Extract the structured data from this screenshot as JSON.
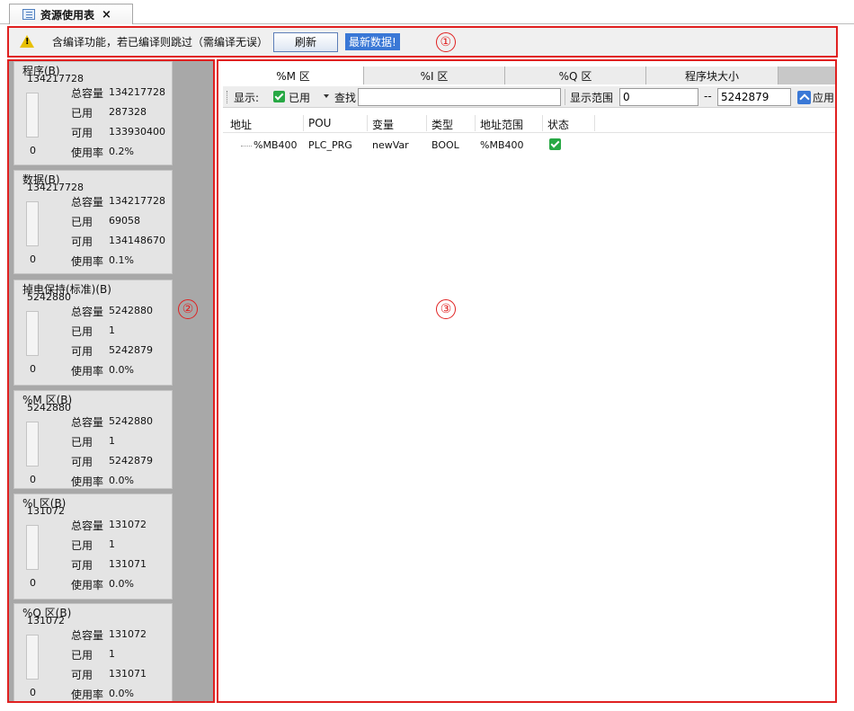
{
  "window": {
    "tab_title": "资源使用表",
    "tab_close": "×"
  },
  "warning_bar": {
    "icon": "warning-icon",
    "message": "含编译功能，若已编译则跳过（需编译无误）",
    "refresh_label": "刷新",
    "latest_label": "最新数据!",
    "callout": "①"
  },
  "left_panel": {
    "callout": "②",
    "labels": {
      "total": "总容量",
      "used": "已用",
      "free": "可用",
      "rate": "使用率"
    },
    "cards": [
      {
        "title": "程序(B)",
        "capacity": "134217728",
        "total": "134217728",
        "used": "287328",
        "free": "133930400",
        "rate": "0.2%",
        "zero": "0"
      },
      {
        "title": "数据(B)",
        "capacity": "134217728",
        "total": "134217728",
        "used": "69058",
        "free": "134148670",
        "rate": "0.1%",
        "zero": "0"
      },
      {
        "title": "掉电保持(标准)(B)",
        "capacity": "5242880",
        "total": "5242880",
        "used": "1",
        "free": "5242879",
        "rate": "0.0%",
        "zero": "0"
      },
      {
        "title": "%M 区(B)",
        "capacity": "5242880",
        "total": "5242880",
        "used": "1",
        "free": "5242879",
        "rate": "0.0%",
        "zero": "0"
      },
      {
        "title": "%I 区(B)",
        "capacity": "131072",
        "total": "131072",
        "used": "1",
        "free": "131071",
        "rate": "0.0%",
        "zero": "0"
      },
      {
        "title": "%Q 区(B)",
        "capacity": "131072",
        "total": "131072",
        "used": "1",
        "free": "131071",
        "rate": "0.0%",
        "zero": "0"
      }
    ]
  },
  "right_panel": {
    "callout": "③",
    "tabs": [
      "%M 区",
      "%I 区",
      "%Q 区",
      "程序块大小"
    ],
    "active_tab": "%M 区",
    "toolbar": {
      "show_label": "显示:",
      "used_label": "已用",
      "find_label": "查找",
      "find_value": "",
      "range_label": "显示范围",
      "range_from": "0",
      "range_sep": "--",
      "range_to": "5242879",
      "apply_label": "应用"
    },
    "columns": [
      "地址",
      "POU",
      "变量",
      "类型",
      "地址范围",
      "状态"
    ],
    "rows": [
      {
        "address": "%MB400",
        "pou": "PLC_PRG",
        "variable": "newVar",
        "type": "BOOL",
        "range": "%MB400",
        "status": "checked"
      }
    ]
  },
  "colors": {
    "callout_red": "#e02020",
    "accent_blue": "#3a78d6",
    "check_green": "#27a844"
  }
}
